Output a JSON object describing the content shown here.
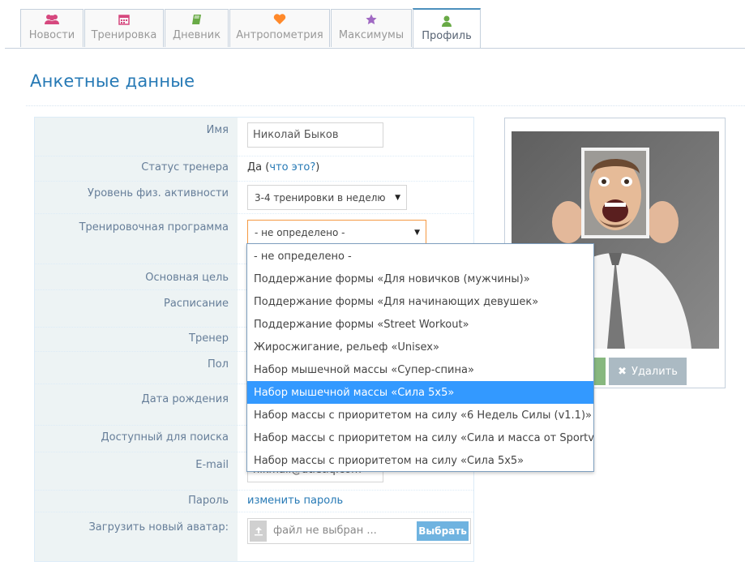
{
  "tabs": [
    {
      "label": "Новости",
      "icon": "users-icon",
      "color": "#d6487e"
    },
    {
      "label": "Тренировка",
      "icon": "calendar-icon",
      "color": "#d6487e"
    },
    {
      "label": "Дневник",
      "icon": "book-icon",
      "color": "#69aa46"
    },
    {
      "label": "Антропометрия",
      "icon": "heart-icon",
      "color": "#ff892a"
    },
    {
      "label": "Максимумы",
      "icon": "star-icon",
      "color": "#a069c3"
    },
    {
      "label": "Профиль",
      "icon": "user-icon",
      "color": "#69aa46",
      "active": true
    }
  ],
  "page_title": "Анкетные данные",
  "form": {
    "name_label": "Имя",
    "name_value": "Николай Быков",
    "trainer_status_label": "Статус тренера",
    "trainer_status_value": "Да",
    "trainer_status_paren_open": "(",
    "trainer_status_link": "что это?",
    "trainer_status_paren_close": ")",
    "activity_label": "Уровень физ. активности",
    "activity_value": "3-4 тренировки в неделю",
    "program_label": "Тренировочная программа",
    "program_value": "- не определено -",
    "goal_label": "Основная цель",
    "schedule_label": "Расписание",
    "coach_label": "Тренер",
    "gender_label": "Пол",
    "birthdate_label": "Дата рождения",
    "searchable_label": "Доступный для поиска",
    "email_label": "E-mail",
    "email_value_partial": "nikmail@atletiq.com",
    "password_label": "Пароль",
    "password_link": "изменить пароль",
    "avatar_label": "Загрузить новый аватар:",
    "file_placeholder": "файл не выбран ...",
    "file_button": "Выбрать"
  },
  "photo_card": {
    "delete_button": "Удалить"
  },
  "program_options": [
    "- не определено -",
    "Поддержание формы «Для новичков (мужчины)»",
    "Поддержание формы «Для начинающих девушек»",
    "Поддержание формы «Street Workout»",
    "Жиросжигание, рельеф «Unisex»",
    "Набор мышечной массы «Супер-спина»",
    "Набор мышечной массы «Сила 5x5»",
    "Набор массы с приоритетом на силу «6 Недель Силы (v1.1)»",
    "Набор массы с приоритетом на силу «Сила и масса от Sportvrach»",
    "Набор массы с приоритетом на силу «Сила 5x5»"
  ],
  "program_selected_index": 6,
  "colors": {
    "accent": "#2679b5",
    "highlight": "#3399ff",
    "label": "#667e99"
  }
}
